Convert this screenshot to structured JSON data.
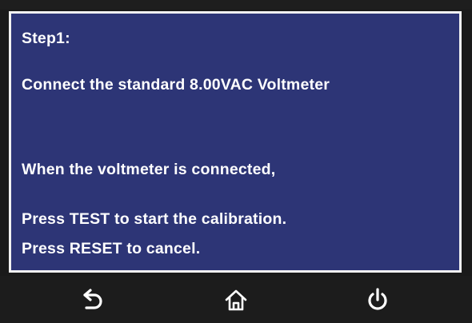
{
  "screen": {
    "lines": [
      "Step1:",
      "Connect the standard 8.00VAC Voltmeter",
      "When the voltmeter is connected,",
      "Press TEST to start the calibration.",
      "Press RESET to cancel."
    ]
  },
  "toolbar": {
    "buttons": [
      {
        "icon": "back-arrow-icon"
      },
      {
        "icon": "home-icon"
      },
      {
        "icon": "power-icon"
      }
    ]
  },
  "colors": {
    "panel_bg": "#2d3576",
    "panel_border": "#f2f2f2",
    "bar_bg": "#1c1c1c",
    "text": "#ffffff"
  }
}
